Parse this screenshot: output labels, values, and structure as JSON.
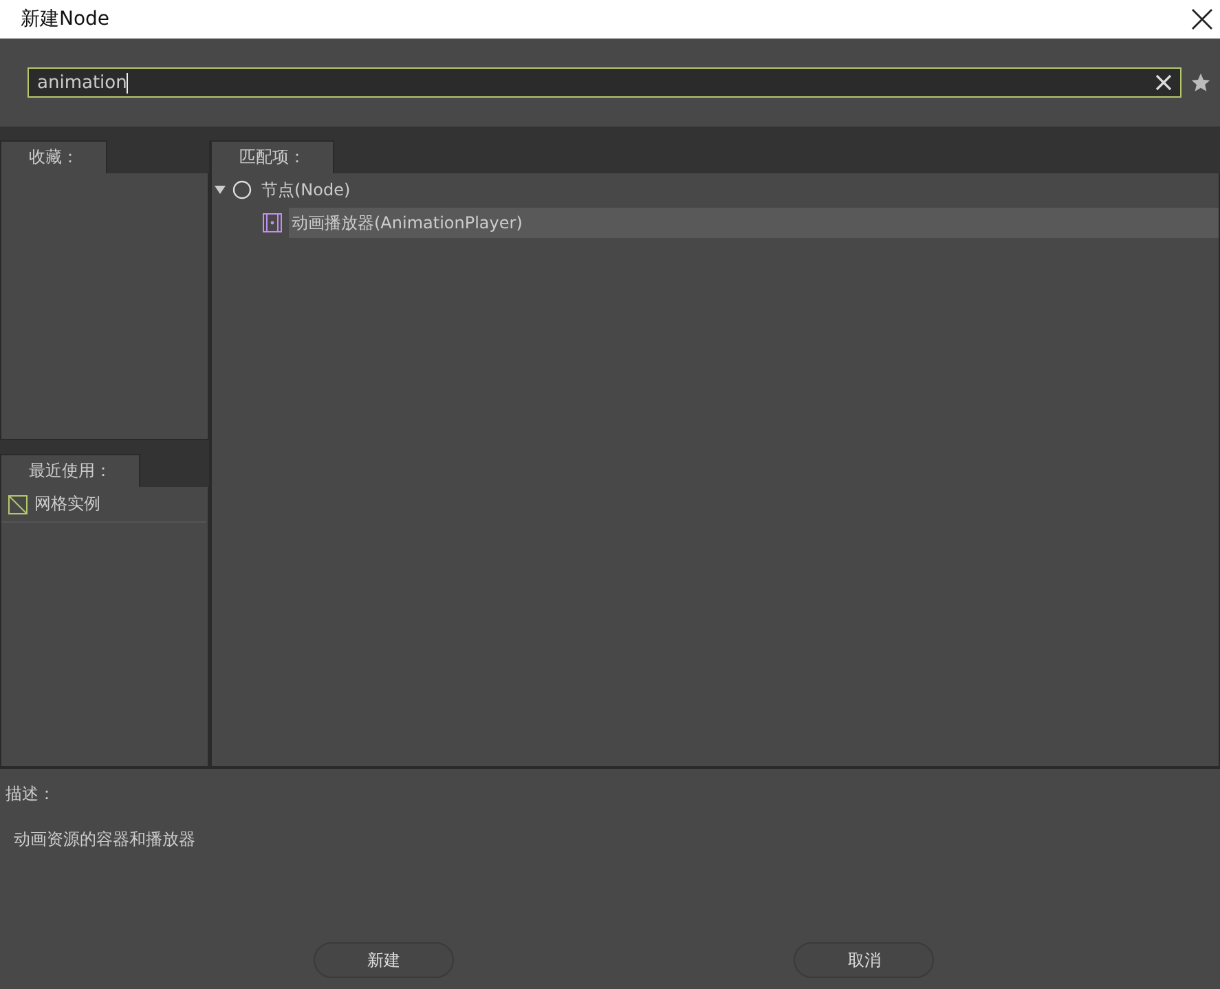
{
  "window": {
    "title": "新建Node"
  },
  "search": {
    "value": "animation"
  },
  "favorites": {
    "tab": "收藏："
  },
  "recent": {
    "tab": "最近使用：",
    "items": [
      {
        "label": "网格实例",
        "selected": false
      }
    ]
  },
  "matches": {
    "tab": "匹配项：",
    "tree": [
      {
        "label": "节点(Node)",
        "expanded": true,
        "selected": false,
        "kind": "node",
        "children": [
          {
            "label": "动画播放器(AnimationPlayer)",
            "selected": true,
            "kind": "animation"
          }
        ]
      }
    ]
  },
  "description": {
    "label": "描述：",
    "text": "动画资源的容器和播放器"
  },
  "buttons": [
    {
      "label": "新建"
    },
    {
      "label": "取消"
    }
  ]
}
